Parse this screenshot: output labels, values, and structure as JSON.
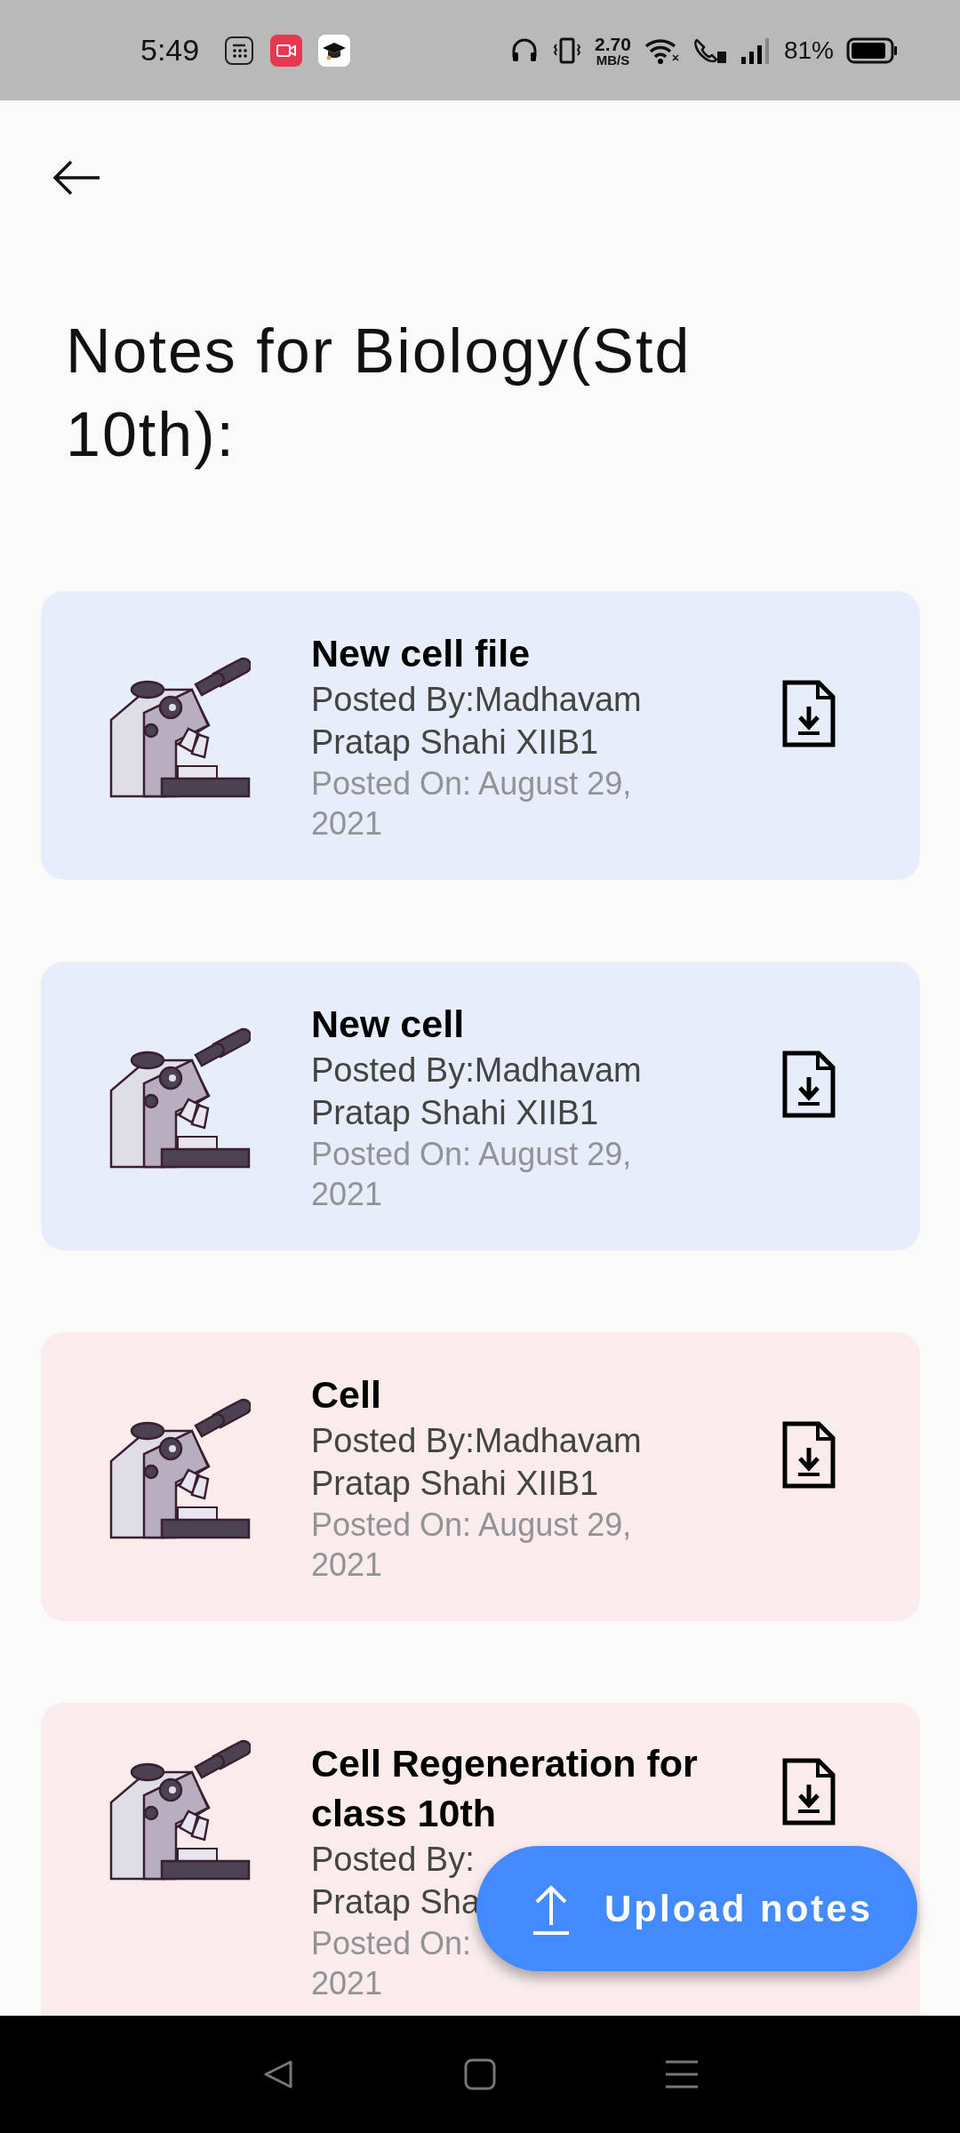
{
  "status_bar": {
    "time": "5:49",
    "speed_value": "2.70",
    "speed_unit": "MB/S",
    "battery": "81%"
  },
  "page": {
    "title": "Notes for Biology(Std 10th):"
  },
  "notes": [
    {
      "title": "New cell file",
      "poster_lines": [
        "Posted By:Madhavam",
        "Pratap Shahi XIIB1"
      ],
      "date_lines": [
        "Posted On: August 29,",
        "2021"
      ],
      "color": "#e8eef9"
    },
    {
      "title": "New cell",
      "poster_lines": [
        "Posted By:Madhavam",
        "Pratap Shahi XIIB1"
      ],
      "date_lines": [
        "Posted On: August 29,",
        "2021"
      ],
      "color": "#e8eef9"
    },
    {
      "title": "Cell",
      "poster_lines": [
        "Posted By:Madhavam",
        "Pratap Shahi XIIB1"
      ],
      "date_lines": [
        "Posted On: August 29,",
        "2021"
      ],
      "color": "#f9eceb"
    },
    {
      "title": "Cell Regeneration for class 10th",
      "poster_lines": [
        "Posted By:",
        "Pratap Sha"
      ],
      "date_lines": [
        "Posted On:",
        "2021"
      ],
      "color": "#f9eceb"
    }
  ],
  "fab": {
    "label": "Upload notes"
  }
}
